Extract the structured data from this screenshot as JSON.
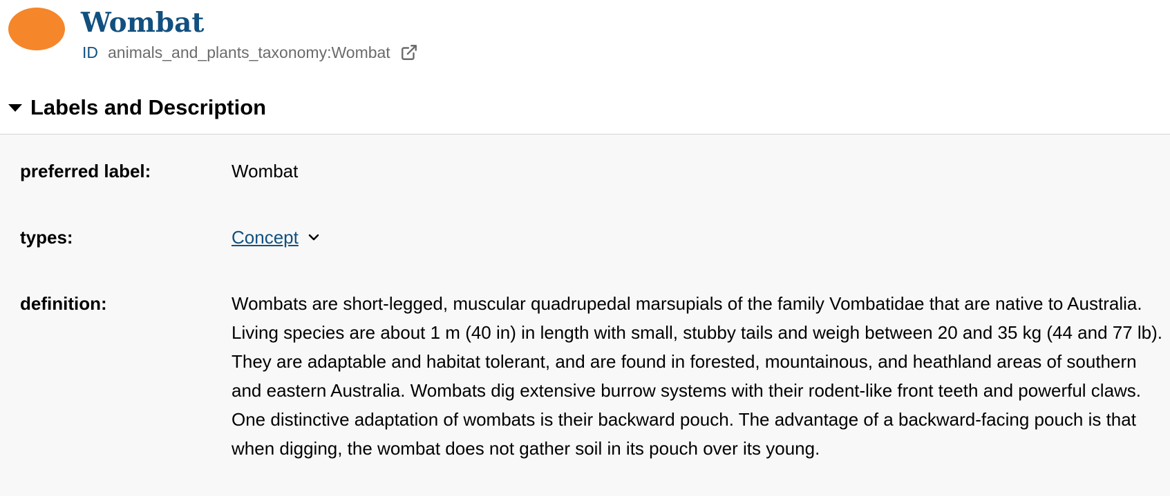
{
  "theme": {
    "accent": "#f5862a",
    "title_color": "#11507f",
    "id_label_color": "#11507f",
    "link_color": "#11507f"
  },
  "entity": {
    "title": "Wombat",
    "id_label": "ID",
    "id_value": "animals_and_plants_taxonomy:Wombat",
    "open_icon": "external-link-icon"
  },
  "section": {
    "title": "Labels and Description",
    "toggle_icon": "caret-down-icon",
    "fields": {
      "preferred_label": {
        "label": "preferred label:",
        "value": "Wombat"
      },
      "types": {
        "label": "types:",
        "value": "Concept",
        "expand_icon": "chevron-down-icon"
      },
      "definition": {
        "label": "definition:",
        "value": "Wombats are short-legged, muscular quadrupedal marsupials of the family Vombatidae that are native to Australia. Living species are about 1 m (40 in) in length with small, stubby tails and weigh between 20 and 35 kg (44 and 77 lb). They are adaptable and habitat tolerant, and are found in forested, mountainous, and heathland areas of southern and eastern Australia. Wombats dig extensive burrow systems with their rodent-like front teeth and powerful claws. One distinctive adaptation of wombats is their backward pouch. The advantage of a backward-facing pouch is that when digging, the wombat does not gather soil in its pouch over its young."
      }
    }
  }
}
